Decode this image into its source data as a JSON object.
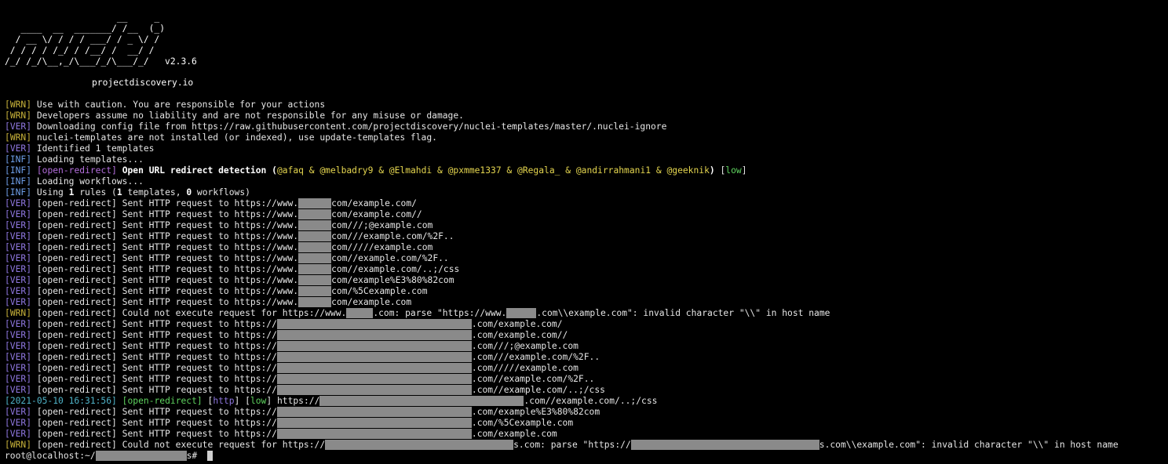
{
  "banner": {
    "ascii": "                     __     _\n   ____  __  _______/ /__  (_)\n  / __ \\/ / / / ___/ / _ \\/ /\n / / / / /_/ / /__/ /  __/ /\n/_/ /_/\\__,_/\\___/_/\\___/_/   v2.3.6",
    "site": "projectdiscovery.io"
  },
  "colors": {
    "background": "#000000",
    "text": "#e6e6e6",
    "wrn": "#c8b23a",
    "ver": "#8f77e0",
    "inf": "#6e9ee8",
    "template": "#b56fde",
    "authors": "#e5d64f",
    "low": "#5fd35f",
    "timestamp": "#4fb3c8",
    "redaction": "#8a8a8a"
  },
  "log": {
    "l0": {
      "tag": "WRN",
      "text": "Use with caution. You are responsible for your actions"
    },
    "l1": {
      "tag": "WRN",
      "text": "Developers assume no liability and are not responsible for any misuse or damage."
    },
    "l2": {
      "tag": "VER",
      "text": "Downloading config file from https://raw.githubusercontent.com/projectdiscovery/nuclei-templates/master/.nuclei-ignore"
    },
    "l3": {
      "tag": "WRN",
      "text": "nuclei-templates are not installed (or indexed), use update-templates flag."
    },
    "l4": {
      "tag": "VER",
      "text": "Identified 1 templates"
    },
    "l5": {
      "tag": "INF",
      "text": "Loading templates..."
    },
    "l6": {
      "tag": "INF",
      "template": "open-redirect",
      "name": "Open URL redirect detection",
      "authors": "@afaq & @melbadry9 & @Elmahdi & @pxmme1337 & @Regala_ & @andirrahmani1 & @geeknik",
      "severity": "low"
    },
    "l7": {
      "tag": "INF",
      "text": "Loading workflows..."
    },
    "l8": {
      "tag": "INF",
      "pre": "Using ",
      "n1": "1",
      "mid1": " rules (",
      "n2": "1",
      "mid2": " templates, ",
      "n3": "0",
      "post": " workflows)"
    },
    "req_prefix": "[open-redirect] Sent HTTP request to ",
    "host_a_prefix": "https://www.",
    "host_a_suffix": [
      "com/example.com/",
      "com/example.com//",
      "com///;@example.com",
      "com///example.com/%2F..",
      "com/////example.com",
      "com//example.com/%2F..",
      "com//example.com/..;/css",
      "com/example%E3%80%82com",
      "com/%5Cexample.com",
      "com/example.com"
    ],
    "err1": {
      "tag": "WRN",
      "prefix": "[open-redirect] Could not execute request for https://www.",
      "mid": ".com: parse \"https://www.",
      "post": ".com\\\\example.com\": invalid character \"\\\\\" in host name"
    },
    "host_b_prefix": "https://",
    "host_b_suffix": [
      ".com/example.com/",
      ".com/example.com//",
      ".com///;@example.com",
      ".com///example.com/%2F..",
      ".com/////example.com",
      ".com//example.com/%2F..",
      ".com//example.com/..;/css"
    ],
    "match": {
      "timestamp": "2021-05-10 16:31:56",
      "template": "open-redirect",
      "protocol": "http",
      "severity": "low",
      "url_prefix": "https://",
      "url_suffix": ".com//example.com/..;/css"
    },
    "host_c_suffix": [
      ".com/example%E3%80%82com",
      ".com/%5Cexample.com",
      ".com/example.com"
    ],
    "err2": {
      "tag": "WRN",
      "prefix": "[open-redirect] Could not execute request for https://",
      "mid": "s.com: parse \"https://",
      "post": "s.com\\\\example.com\": invalid character \"\\\\\" in host name"
    },
    "prompt": {
      "prefix": "root@localhost:~/",
      "suffix": "s# "
    }
  }
}
